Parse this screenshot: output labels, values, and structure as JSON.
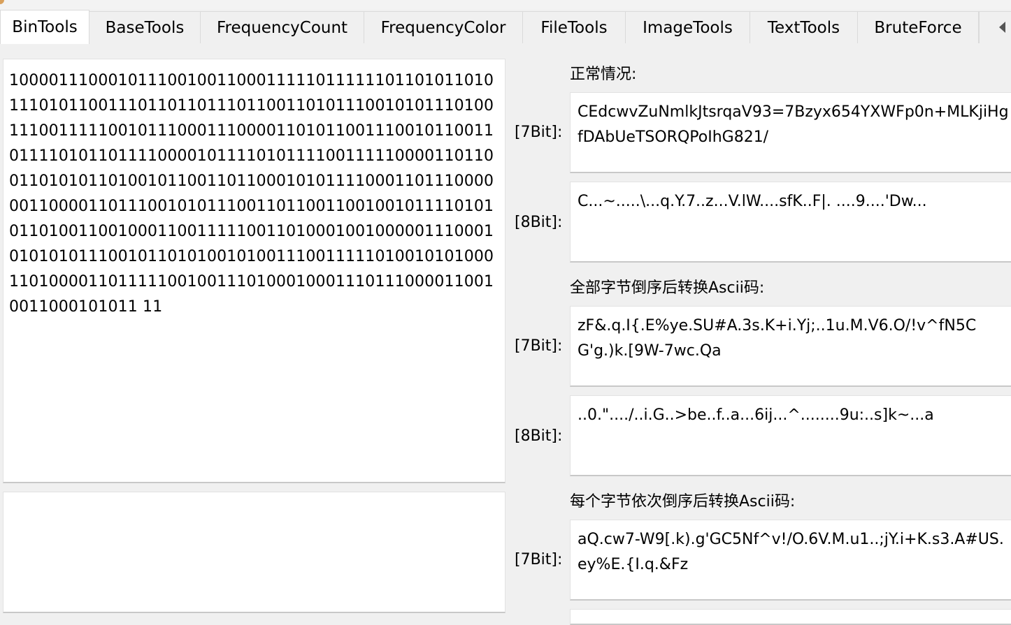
{
  "tabs": [
    {
      "label": "BinTools",
      "active": true
    },
    {
      "label": "BaseTools",
      "active": false
    },
    {
      "label": "FrequencyCount",
      "active": false
    },
    {
      "label": "FrequencyColor",
      "active": false
    },
    {
      "label": "FileTools",
      "active": false
    },
    {
      "label": "ImageTools",
      "active": false
    },
    {
      "label": "TextTools",
      "active": false
    },
    {
      "label": "BruteForce",
      "active": false
    }
  ],
  "binary_input": "1000011100010111001001100011111011111101101011010111010110011101101101110110011010111001010111010011100111110010111000111000011010110011100101100110111101011011110000101111010111100111110000110110011010101101001011001101100010101111000110111000000110000110111001010111001101100110010010111101010110100110010001100111110011010001001000001110001010101011100101101010010100111001111101001010100011010000110111110010011101000100011101110000110010011000101011 11",
  "binary_output": "",
  "normal": {
    "heading": "正常情况:",
    "seven_bit_label": "[7Bit]:",
    "seven_bit_value": "CEdcwvZuNmlkJtsrqaV93=7Bzyx654YXWFp0n+MLKjiHgfDAbUeTSORQPoIhG821/",
    "eight_bit_label": "[8Bit]:",
    "eight_bit_value": "C...~.....\\...q.Y.7..z...V.lW....sfK..F|. ....9....'Dw..."
  },
  "reverse_all": {
    "heading": "全部字节倒序后转换Ascii码:",
    "seven_bit_label": "[7Bit]:",
    "seven_bit_value": "zF&.q.I{.E%ye.SU#A.3s.K+i.Yj;..1u.M.V6.O/!v^fN5CG'g.)k.[9W-7wc.Qa",
    "eight_bit_label": "[8Bit]:",
    "eight_bit_value": "..0.\"..../..i.G..>be..f..a...6ij...^........9u:..s]k~...a"
  },
  "reverse_each": {
    "heading": "每个字节依次倒序后转换Ascii码:",
    "seven_bit_label": "[7Bit]:",
    "seven_bit_value": "aQ.cw7-W9[.k).g'GC5Nf^v!/O.6V.M.u1..;jY.i+K.s3.A#US.ey%E.{I.q.&Fz"
  },
  "colors": {
    "background": "#f0f0f0",
    "textbox": "#ffffff",
    "border": "#dadada"
  },
  "icons": {
    "tab_scroll": "chevron-left-icon"
  }
}
